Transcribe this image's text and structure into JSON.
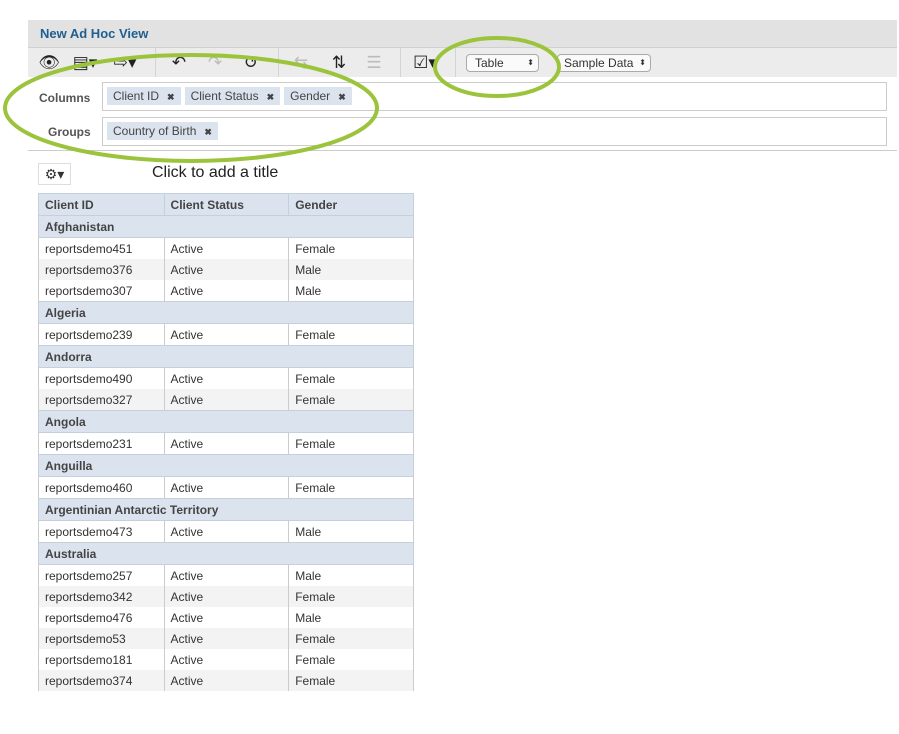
{
  "header": {
    "title": "New Ad Hoc View"
  },
  "toolbar": {
    "view_type": "Table",
    "data_mode": "Sample Data",
    "icons": [
      "eye-icon",
      "save-icon",
      "export-icon",
      "undo-icon",
      "redo-icon",
      "undo-all-icon",
      "switch-group-icon",
      "sort-icon",
      "input-controls-icon",
      "checklist-icon"
    ]
  },
  "columns": {
    "label": "Columns",
    "items": [
      {
        "label": "Client ID"
      },
      {
        "label": "Client Status"
      },
      {
        "label": "Gender"
      }
    ]
  },
  "groups": {
    "label": "Groups",
    "items": [
      {
        "label": "Country of Birth"
      }
    ]
  },
  "canvas": {
    "title_placeholder": "Click to add a title"
  },
  "table": {
    "headers": [
      "Client ID",
      "Client Status",
      "Gender"
    ],
    "groups": [
      {
        "name": "Afghanistan",
        "rows": [
          [
            "reportsdemo451",
            "Active",
            "Female"
          ],
          [
            "reportsdemo376",
            "Active",
            "Male"
          ],
          [
            "reportsdemo307",
            "Active",
            "Male"
          ]
        ]
      },
      {
        "name": "Algeria",
        "rows": [
          [
            "reportsdemo239",
            "Active",
            "Female"
          ]
        ]
      },
      {
        "name": "Andorra",
        "rows": [
          [
            "reportsdemo490",
            "Active",
            "Female"
          ],
          [
            "reportsdemo327",
            "Active",
            "Female"
          ]
        ]
      },
      {
        "name": "Angola",
        "rows": [
          [
            "reportsdemo231",
            "Active",
            "Female"
          ]
        ]
      },
      {
        "name": "Anguilla",
        "rows": [
          [
            "reportsdemo460",
            "Active",
            "Female"
          ]
        ]
      },
      {
        "name": "Argentinian Antarctic Territory",
        "rows": [
          [
            "reportsdemo473",
            "Active",
            "Male"
          ]
        ]
      },
      {
        "name": "Australia",
        "rows": [
          [
            "reportsdemo257",
            "Active",
            "Male"
          ],
          [
            "reportsdemo342",
            "Active",
            "Female"
          ],
          [
            "reportsdemo476",
            "Active",
            "Male"
          ],
          [
            "reportsdemo53",
            "Active",
            "Female"
          ],
          [
            "reportsdemo181",
            "Active",
            "Female"
          ],
          [
            "reportsdemo374",
            "Active",
            "Female"
          ]
        ]
      }
    ]
  },
  "colors": {
    "highlight": "#9bc43c",
    "title": "#1f5f8f",
    "pill": "#dbe4ee"
  }
}
